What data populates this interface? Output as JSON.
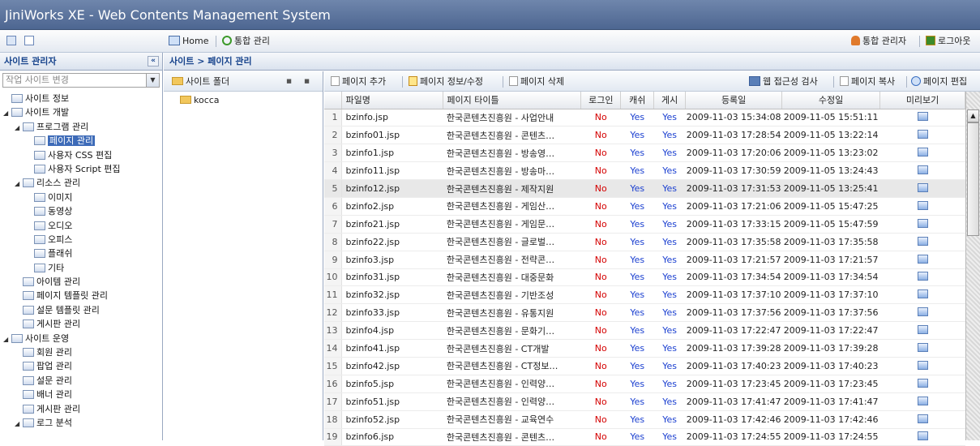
{
  "app": {
    "title": "JiniWorks XE - Web Contents Management System"
  },
  "toolbar": {
    "home": "Home",
    "integrated": "통합 관리",
    "admin": "통합 관리자",
    "logout": "로그아웃"
  },
  "left_panel": {
    "title": "사이트 관리자",
    "site_combo_placeholder": "작업 사이트 변경",
    "tree": [
      {
        "label": "사이트 정보",
        "indent": 0,
        "toggle": ""
      },
      {
        "label": "사이트 개발",
        "indent": 0,
        "toggle": "◢"
      },
      {
        "label": "프로그램 관리",
        "indent": 1,
        "toggle": "◢"
      },
      {
        "label": "페이지 관리",
        "indent": 2,
        "toggle": "",
        "selected": true
      },
      {
        "label": "사용자 CSS 편집",
        "indent": 2,
        "toggle": ""
      },
      {
        "label": "사용자 Script 편집",
        "indent": 2,
        "toggle": ""
      },
      {
        "label": "리소스 관리",
        "indent": 1,
        "toggle": "◢"
      },
      {
        "label": "이미지",
        "indent": 2,
        "toggle": ""
      },
      {
        "label": "동영상",
        "indent": 2,
        "toggle": ""
      },
      {
        "label": "오디오",
        "indent": 2,
        "toggle": ""
      },
      {
        "label": "오피스",
        "indent": 2,
        "toggle": ""
      },
      {
        "label": "플래쉬",
        "indent": 2,
        "toggle": ""
      },
      {
        "label": "기타",
        "indent": 2,
        "toggle": ""
      },
      {
        "label": "아이템 관리",
        "indent": 1,
        "toggle": ""
      },
      {
        "label": "페이지 템플릿 관리",
        "indent": 1,
        "toggle": ""
      },
      {
        "label": "설문 템플릿 관리",
        "indent": 1,
        "toggle": ""
      },
      {
        "label": "게시판 관리",
        "indent": 1,
        "toggle": ""
      },
      {
        "label": "사이트 운영",
        "indent": 0,
        "toggle": "◢"
      },
      {
        "label": "회원 관리",
        "indent": 1,
        "toggle": ""
      },
      {
        "label": "팝업 관리",
        "indent": 1,
        "toggle": ""
      },
      {
        "label": "설문 관리",
        "indent": 1,
        "toggle": ""
      },
      {
        "label": "배너 관리",
        "indent": 1,
        "toggle": ""
      },
      {
        "label": "게시판 관리",
        "indent": 1,
        "toggle": ""
      },
      {
        "label": "로그 분석",
        "indent": 1,
        "toggle": "◢"
      }
    ]
  },
  "breadcrumb": "사이트 > 페이지 관리",
  "folder_panel": {
    "title": "사이트 폴더",
    "items": [
      "kocca"
    ]
  },
  "page_toolbar": {
    "add": "페이지 추가",
    "edit": "페이지 정보/수정",
    "delete": "페이지 삭제",
    "access": "웹 접근성 검사",
    "copy": "페이지 복사",
    "page_edit": "페이지 편집"
  },
  "table": {
    "columns": [
      "파일명",
      "페이지 타이틀",
      "로그인",
      "캐쉬",
      "게시",
      "등록일",
      "수정일",
      "미리보기"
    ],
    "rows": [
      {
        "n": "1",
        "file": "bzinfo.jsp",
        "title": "한국콘텐츠진흥원 - 사업안내",
        "login": "No",
        "cache": "Yes",
        "post": "Yes",
        "reg": "2009-11-03 15:34:08",
        "mod": "2009-11-05 15:51:11"
      },
      {
        "n": "2",
        "file": "bzinfo01.jsp",
        "title": "한국콘텐츠진흥원 - 콘텐츠…",
        "login": "No",
        "cache": "Yes",
        "post": "Yes",
        "reg": "2009-11-03 17:28:54",
        "mod": "2009-11-05 13:22:14"
      },
      {
        "n": "3",
        "file": "bzinfo1.jsp",
        "title": "한국콘텐츠진흥원 - 방송영…",
        "login": "No",
        "cache": "Yes",
        "post": "Yes",
        "reg": "2009-11-03 17:20:06",
        "mod": "2009-11-05 13:23:02"
      },
      {
        "n": "4",
        "file": "bzinfo11.jsp",
        "title": "한국콘텐츠진흥원 - 방송마…",
        "login": "No",
        "cache": "Yes",
        "post": "Yes",
        "reg": "2009-11-03 17:30:59",
        "mod": "2009-11-05 13:24:43"
      },
      {
        "n": "5",
        "file": "bzinfo12.jsp",
        "title": "한국콘텐츠진흥원 - 제작지원",
        "login": "No",
        "cache": "Yes",
        "post": "Yes",
        "reg": "2009-11-03 17:31:53",
        "mod": "2009-11-05 13:25:41"
      },
      {
        "n": "6",
        "file": "bzinfo2.jsp",
        "title": "한국콘텐츠진흥원 - 게임산…",
        "login": "No",
        "cache": "Yes",
        "post": "Yes",
        "reg": "2009-11-03 17:21:06",
        "mod": "2009-11-05 15:47:25"
      },
      {
        "n": "7",
        "file": "bzinfo21.jsp",
        "title": "한국콘텐츠진흥원 - 게임문…",
        "login": "No",
        "cache": "Yes",
        "post": "Yes",
        "reg": "2009-11-03 17:33:15",
        "mod": "2009-11-05 15:47:59"
      },
      {
        "n": "8",
        "file": "bzinfo22.jsp",
        "title": "한국콘텐츠진흥원 - 글로벌…",
        "login": "No",
        "cache": "Yes",
        "post": "Yes",
        "reg": "2009-11-03 17:35:58",
        "mod": "2009-11-03 17:35:58"
      },
      {
        "n": "9",
        "file": "bzinfo3.jsp",
        "title": "한국콘텐츠진흥원 - 전략콘…",
        "login": "No",
        "cache": "Yes",
        "post": "Yes",
        "reg": "2009-11-03 17:21:57",
        "mod": "2009-11-03 17:21:57"
      },
      {
        "n": "10",
        "file": "bzinfo31.jsp",
        "title": "한국콘텐츠진흥원 - 대중문화",
        "login": "No",
        "cache": "Yes",
        "post": "Yes",
        "reg": "2009-11-03 17:34:54",
        "mod": "2009-11-03 17:34:54"
      },
      {
        "n": "11",
        "file": "bzinfo32.jsp",
        "title": "한국콘텐츠진흥원 - 기반조성",
        "login": "No",
        "cache": "Yes",
        "post": "Yes",
        "reg": "2009-11-03 17:37:10",
        "mod": "2009-11-03 17:37:10"
      },
      {
        "n": "12",
        "file": "bzinfo33.jsp",
        "title": "한국콘텐츠진흥원 - 유통지원",
        "login": "No",
        "cache": "Yes",
        "post": "Yes",
        "reg": "2009-11-03 17:37:56",
        "mod": "2009-11-03 17:37:56"
      },
      {
        "n": "13",
        "file": "bzinfo4.jsp",
        "title": "한국콘텐츠진흥원 - 문화기…",
        "login": "No",
        "cache": "Yes",
        "post": "Yes",
        "reg": "2009-11-03 17:22:47",
        "mod": "2009-11-03 17:22:47"
      },
      {
        "n": "14",
        "file": "bzinfo41.jsp",
        "title": "한국콘텐츠진흥원 - CT개발",
        "login": "No",
        "cache": "Yes",
        "post": "Yes",
        "reg": "2009-11-03 17:39:28",
        "mod": "2009-11-03 17:39:28"
      },
      {
        "n": "15",
        "file": "bzinfo42.jsp",
        "title": "한국콘텐츠진흥원 - CT정보…",
        "login": "No",
        "cache": "Yes",
        "post": "Yes",
        "reg": "2009-11-03 17:40:23",
        "mod": "2009-11-03 17:40:23"
      },
      {
        "n": "16",
        "file": "bzinfo5.jsp",
        "title": "한국콘텐츠진흥원 - 인력양…",
        "login": "No",
        "cache": "Yes",
        "post": "Yes",
        "reg": "2009-11-03 17:23:45",
        "mod": "2009-11-03 17:23:45"
      },
      {
        "n": "17",
        "file": "bzinfo51.jsp",
        "title": "한국콘텐츠진흥원 - 인력양…",
        "login": "No",
        "cache": "Yes",
        "post": "Yes",
        "reg": "2009-11-03 17:41:47",
        "mod": "2009-11-03 17:41:47"
      },
      {
        "n": "18",
        "file": "bzinfo52.jsp",
        "title": "한국콘텐츠진흥원 - 교육연수",
        "login": "No",
        "cache": "Yes",
        "post": "Yes",
        "reg": "2009-11-03 17:42:46",
        "mod": "2009-11-03 17:42:46"
      },
      {
        "n": "19",
        "file": "bzinfo6.jsp",
        "title": "한국콘텐츠진흥원 - 콘텐츠…",
        "login": "No",
        "cache": "Yes",
        "post": "Yes",
        "reg": "2009-11-03 17:24:55",
        "mod": "2009-11-03 17:24:55"
      }
    ],
    "highlighted_row": 5
  }
}
